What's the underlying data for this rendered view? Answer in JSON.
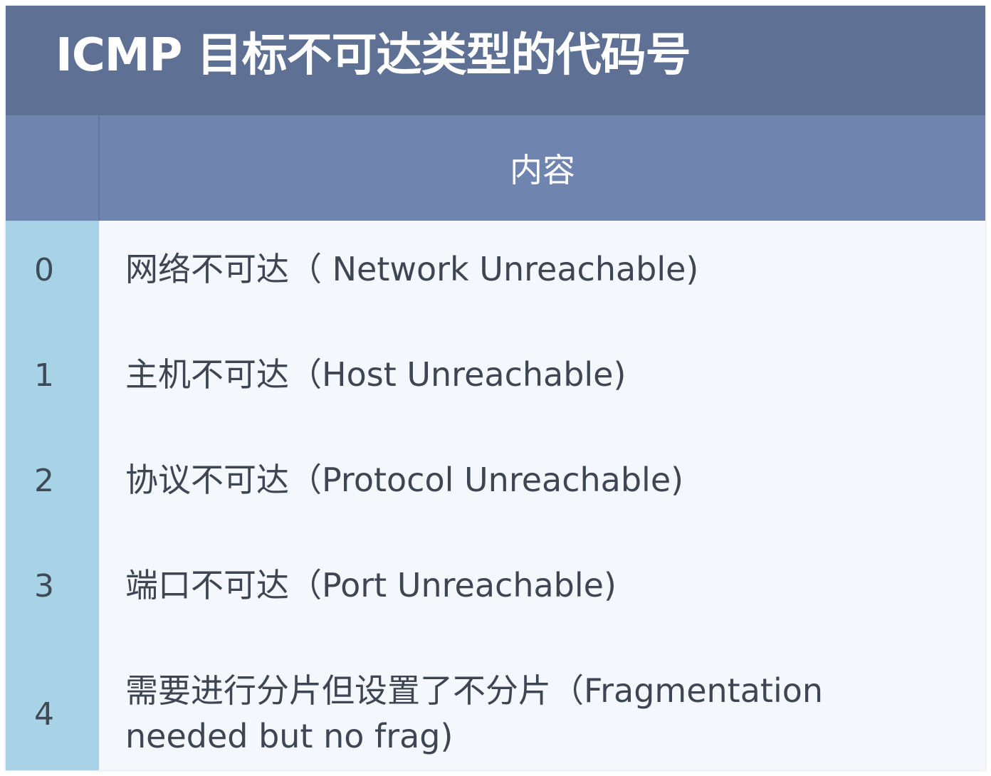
{
  "title": "ICMP 目标不可达类型的代码号",
  "table": {
    "header_code": "",
    "header_content": "内容",
    "rows": [
      {
        "code": "0",
        "content_lines": [
          "网络不可达（ Network Unreachable)"
        ]
      },
      {
        "code": "1",
        "content_lines": [
          "主机不可达（Host Unreachable)"
        ]
      },
      {
        "code": "2",
        "content_lines": [
          "协议不可达（Protocol Unreachable)"
        ]
      },
      {
        "code": "3",
        "content_lines": [
          "端口不可达（Port Unreachable)"
        ]
      },
      {
        "code": "4",
        "content_lines": [
          "需要进行分片但设置了不分片（Fragmentation",
          "needed but no frag)"
        ]
      }
    ]
  },
  "colors": {
    "title_bg": "#5e7093",
    "header_bg": "#7084b0",
    "code_col_bg": "#a8d3e6",
    "body_bg": "#f4f7fc"
  }
}
